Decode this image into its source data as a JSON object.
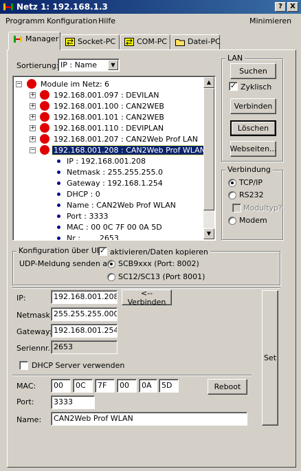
{
  "window": {
    "title": "Netz 1: 192.168.1.3",
    "help_btn": "?",
    "close_btn": "X"
  },
  "menu": {
    "programm": "Programm",
    "konfiguration": "Konfiguration",
    "hilfe": "Hilfe",
    "minimieren": "Minimieren"
  },
  "tabs": [
    {
      "label": "Manager",
      "active": true
    },
    {
      "label": "Socket-PC"
    },
    {
      "label": "COM-PC"
    },
    {
      "label": "Datei-PC"
    }
  ],
  "sort": {
    "label": "Sortierung:",
    "value": "IP : Name"
  },
  "tree": {
    "root": "Module im Netz: 6",
    "modules": [
      "192.168.001.097 : DEVILAN",
      "192.168.001.100 : CAN2WEB",
      "192.168.001.101 : CAN2WEB",
      "192.168.001.110 : DEVIPLAN",
      "192.168.001.207 : CAN2Web Prof LAN",
      "192.168.001.208 : CAN2Web Prof WLAN"
    ],
    "details": [
      "IP : 192.168.001.208",
      "Netmask : 255.255.255.0",
      "Gateway : 192.168.1.254",
      "DHCP : 0",
      "Name : CAN2Web Prof WLAN",
      "Port : 3333",
      "MAC : 00 0C 7F 00 0A 5D",
      "Nr :        2653"
    ]
  },
  "lan": {
    "group_label": "LAN",
    "suchen": "Suchen",
    "zyklisch": "Zyklisch",
    "verbinden": "Verbinden",
    "loeschen": "Löschen",
    "webseiten": "Webseiten..."
  },
  "verbindung": {
    "group_label": "Verbindung",
    "tcpip": "TCP/IP",
    "rs232": "RS232",
    "modultyp": "Modultyp?",
    "modem": "Modem"
  },
  "udp": {
    "group_label": "Konfiguration über UDP",
    "aktivieren": "aktivieren/Daten kopieren",
    "senden_label": "UDP-Meldung senden an:",
    "opt1": "SCB9xxx (Port: 8002)",
    "opt2": "SC12/SC13 (Port 8001)"
  },
  "config": {
    "ip_label": "IP:",
    "ip": "192.168.001.208",
    "verbinden_btn": "<--Verbinden",
    "netmask_label": "Netmask:",
    "netmask": "255.255.255.000",
    "gateway_label": "Gateway:",
    "gateway": "192.168.001.254",
    "serien_label": "Seriennr.:",
    "serien": "2653",
    "dhcp_label": "DHCP Server verwenden",
    "set_btn": "Set",
    "mac_label": "MAC:",
    "mac": [
      "00",
      "0C",
      "7F",
      "00",
      "0A",
      "5D"
    ],
    "reboot_btn": "Reboot",
    "port_label": "Port:",
    "port": "3333",
    "name_label": "Name:",
    "name": "CAN2Web Prof WLAN"
  }
}
